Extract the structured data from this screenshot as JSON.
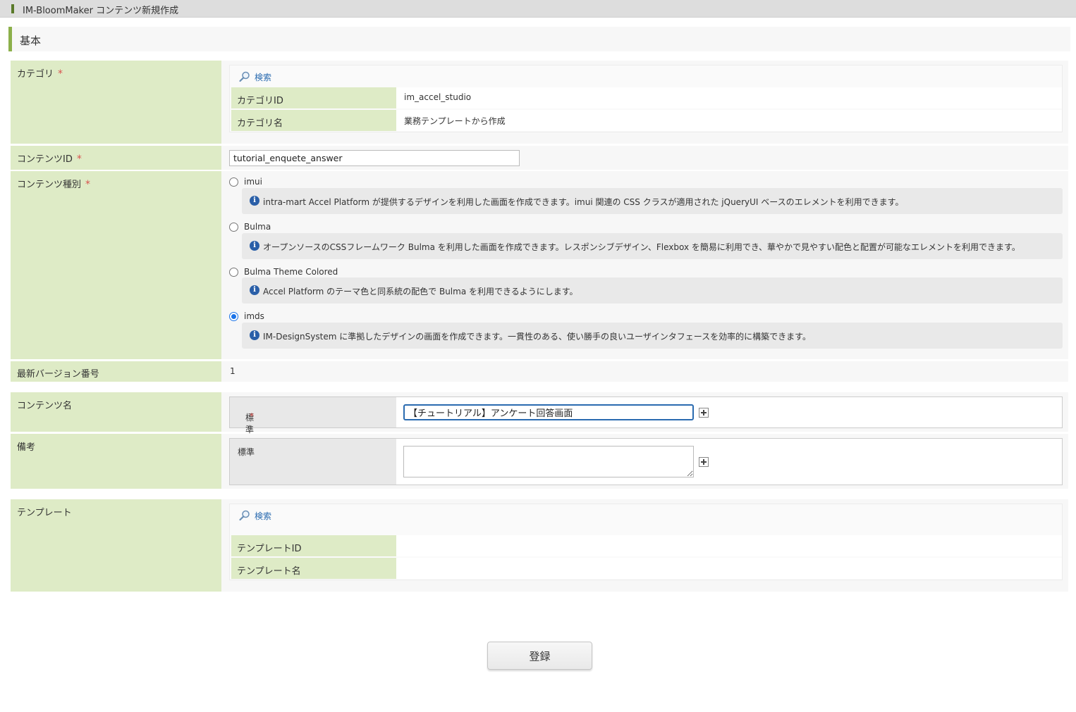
{
  "window": {
    "title": "IM-BloomMaker コンテンツ新規作成"
  },
  "section": {
    "title": "基本"
  },
  "category": {
    "label": "カテゴリ",
    "required": "*",
    "search_label": "検索",
    "id_label": "カテゴリID",
    "id_value": "im_accel_studio",
    "name_label": "カテゴリ名",
    "name_value": "業務テンプレートから作成"
  },
  "content_id": {
    "label": "コンテンツID",
    "required": "*",
    "value": "tutorial_enquete_answer"
  },
  "content_type": {
    "label": "コンテンツ種別",
    "required": "*",
    "options": [
      {
        "label": "imui",
        "checked": false,
        "info": "intra-mart Accel Platform が提供するデザインを利用した画面を作成できます。imui 関連の CSS クラスが適用された jQueryUI ベースのエレメントを利用できます。"
      },
      {
        "label": "Bulma",
        "checked": false,
        "info": "オープンソースのCSSフレームワーク Bulma を利用した画面を作成できます。レスポンシブデザイン、Flexbox を簡易に利用でき、華やかで見やすい配色と配置が可能なエレメントを利用できます。"
      },
      {
        "label": "Bulma Theme Colored",
        "checked": false,
        "info": "Accel Platform のテーマ色と同系統の配色で Bulma を利用できるようにします。"
      },
      {
        "label": "imds",
        "checked": true,
        "info": "IM-DesignSystem に準拠したデザインの画面を作成できます。一貫性のある、使い勝手の良いユーザインタフェースを効率的に構築できます。"
      }
    ]
  },
  "latest_version": {
    "label": "最新バージョン番号",
    "value": "1"
  },
  "content_name": {
    "label": "コンテンツ名",
    "locale_label": "標準",
    "required": "*",
    "value": "【チュートリアル】アンケート回答画面"
  },
  "notes": {
    "label": "備考",
    "locale_label": "標準",
    "value": ""
  },
  "template": {
    "label": "テンプレート",
    "search_label": "検索",
    "id_label": "テンプレートID",
    "id_value": "",
    "name_label": "テンプレート名",
    "name_value": ""
  },
  "actions": {
    "submit_label": "登録"
  },
  "colors": {
    "label_bg": "#deebc6",
    "accent": "#8cb04a",
    "link": "#2a6bb0",
    "required": "#d9534f",
    "radio_selected": "#1a73e8"
  }
}
